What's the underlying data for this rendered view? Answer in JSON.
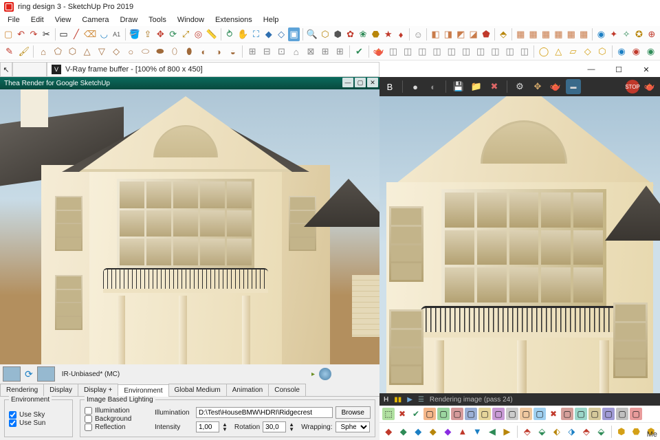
{
  "app": {
    "title": "ring design 3 - SketchUp Pro 2019"
  },
  "menu": [
    "File",
    "Edit",
    "View",
    "Camera",
    "Draw",
    "Tools",
    "Window",
    "Extensions",
    "Help"
  ],
  "vfb": {
    "title": "V-Ray frame buffer - [100% of 800 x 450]"
  },
  "thea": {
    "title": "Thea Render for Google SketchUp",
    "mode": "IR-Unbiased* (MC)",
    "tabs": [
      "Rendering",
      "Display",
      "Display +",
      "Environment",
      "Global Medium",
      "Animation",
      "Console"
    ],
    "active_tab": 3,
    "env": {
      "legend": "Environment",
      "use_sky": "Use Sky",
      "use_sun": "Use Sun"
    },
    "ibl": {
      "legend": "Image Based Lighting",
      "illumination_chk": "Illumination",
      "background_chk": "Background",
      "reflection_chk": "Reflection",
      "illum_label": "Illumination",
      "illum_path": "D:\\Test\\HouseBMW\\HDRI\\Ridgecrest",
      "browse": "Browse",
      "intensity_label": "Intensity",
      "intensity_val": "1,00",
      "rotation_label": "Rotation",
      "rotation_val": "30,0",
      "wrapping_label": "Wrapping:",
      "wrapping_val": "Spheri"
    }
  },
  "right": {
    "toolbar_b": "B",
    "status": "Rendering image (pass 24)",
    "status_h": "H"
  },
  "footer": {
    "me": "Me"
  }
}
